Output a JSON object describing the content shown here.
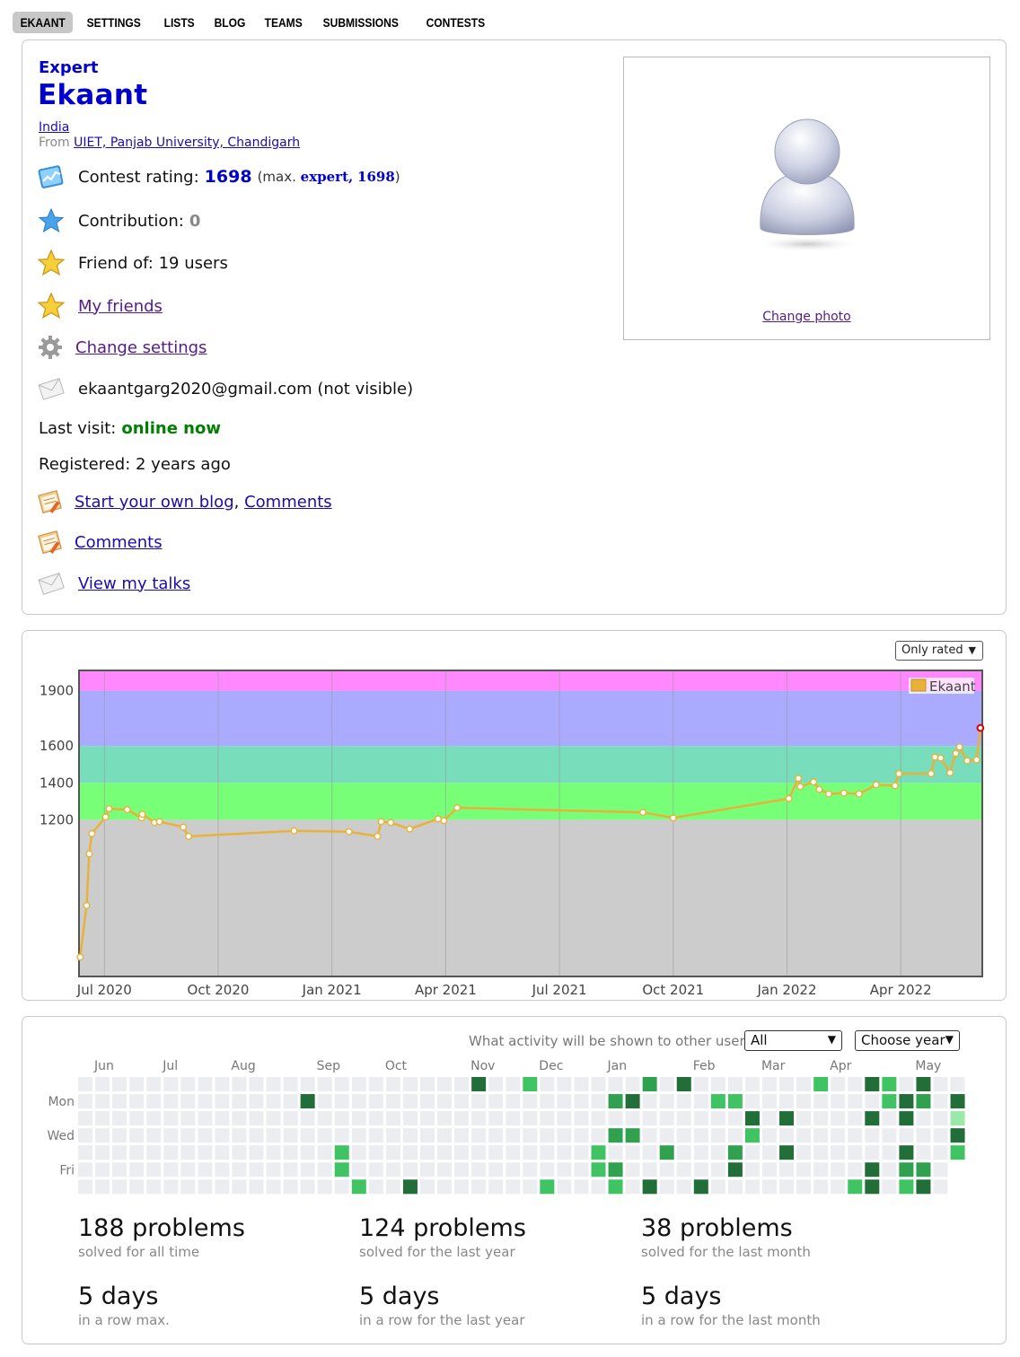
{
  "nav": {
    "tabs": [
      {
        "label": "EKAANT",
        "active": true
      },
      {
        "label": "SETTINGS"
      },
      {
        "label": "LISTS"
      },
      {
        "label": "BLOG"
      },
      {
        "label": "TEAMS"
      },
      {
        "label": "SUBMISSIONS"
      },
      {
        "label": "CONTESTS"
      }
    ]
  },
  "profile": {
    "rank": "Expert",
    "handle": "Ekaant",
    "country": "India",
    "from_label": "From",
    "organization": "UIET, Panjab University, Chandigarh",
    "rating_label": "Contest rating:",
    "rating": "1698",
    "max_prefix": "(max.",
    "max_rank": "expert,",
    "max_rating": "1698",
    "max_suffix": ")",
    "contribution_label": "Contribution:",
    "contribution": "0",
    "friend_of": "Friend of: 19 users",
    "my_friends": "My friends",
    "change_settings": "Change settings",
    "email": "ekaantgarg2020@gmail.com (not visible)",
    "last_visit_label": "Last visit:",
    "last_visit": "online now",
    "registered": "Registered: 2 years ago",
    "blog_link": "Start your own blog",
    "comma": ",",
    "comments_link": "Comments",
    "comments_link2": "Comments",
    "talks_link": "View my talks",
    "change_photo": "Change photo"
  },
  "rating_chart": {
    "filter": "Only rated"
  },
  "chart_data": {
    "type": "line",
    "legend": "Ekaant",
    "x_ticks": [
      "Jul 2020",
      "Oct 2020",
      "Jan 2021",
      "Apr 2021",
      "Jul 2021",
      "Oct 2021",
      "Jan 2022",
      "Apr 2022"
    ],
    "x_tick_months": [
      0,
      3,
      6,
      9,
      12,
      15,
      18,
      21
    ],
    "y_ticks": [
      1200,
      1400,
      1600,
      1900
    ],
    "ylim": [
      350,
      2010
    ],
    "bands": [
      {
        "from": 350,
        "to": 1200,
        "color": "#cccccc"
      },
      {
        "from": 1200,
        "to": 1400,
        "color": "#77ff77"
      },
      {
        "from": 1400,
        "to": 1600,
        "color": "#77ddbb"
      },
      {
        "from": 1600,
        "to": 1900,
        "color": "#aaaaff"
      },
      {
        "from": 1900,
        "to": 2010,
        "color": "#ff88ff"
      }
    ],
    "line_color": "#e8b23a",
    "highlight_color": "#dd0000",
    "points": [
      {
        "m": -0.64,
        "r": 455
      },
      {
        "m": -0.47,
        "r": 735
      },
      {
        "m": -0.4,
        "r": 1015
      },
      {
        "m": -0.33,
        "r": 1125
      },
      {
        "m": 0.03,
        "r": 1215
      },
      {
        "m": 0.12,
        "r": 1260
      },
      {
        "m": 0.6,
        "r": 1255
      },
      {
        "m": 0.98,
        "r": 1210
      },
      {
        "m": 1.0,
        "r": 1230
      },
      {
        "m": 1.32,
        "r": 1185
      },
      {
        "m": 1.45,
        "r": 1190
      },
      {
        "m": 2.08,
        "r": 1160
      },
      {
        "m": 2.22,
        "r": 1110
      },
      {
        "m": 5.0,
        "r": 1140
      },
      {
        "m": 6.45,
        "r": 1135
      },
      {
        "m": 7.2,
        "r": 1110
      },
      {
        "m": 7.3,
        "r": 1190
      },
      {
        "m": 7.55,
        "r": 1185
      },
      {
        "m": 8.05,
        "r": 1150
      },
      {
        "m": 8.8,
        "r": 1205
      },
      {
        "m": 8.95,
        "r": 1195
      },
      {
        "m": 9.3,
        "r": 1265
      },
      {
        "m": 14.2,
        "r": 1240
      },
      {
        "m": 15.0,
        "r": 1210
      },
      {
        "m": 18.05,
        "r": 1315
      },
      {
        "m": 18.3,
        "r": 1425
      },
      {
        "m": 18.35,
        "r": 1380
      },
      {
        "m": 18.7,
        "r": 1405
      },
      {
        "m": 18.85,
        "r": 1365
      },
      {
        "m": 19.1,
        "r": 1340
      },
      {
        "m": 19.5,
        "r": 1345
      },
      {
        "m": 19.9,
        "r": 1340
      },
      {
        "m": 20.35,
        "r": 1390
      },
      {
        "m": 20.85,
        "r": 1385
      },
      {
        "m": 20.95,
        "r": 1450
      },
      {
        "m": 21.8,
        "r": 1450
      },
      {
        "m": 21.9,
        "r": 1540
      },
      {
        "m": 22.05,
        "r": 1535
      },
      {
        "m": 22.3,
        "r": 1455
      },
      {
        "m": 22.45,
        "r": 1560
      },
      {
        "m": 22.55,
        "r": 1595
      },
      {
        "m": 22.75,
        "r": 1520
      },
      {
        "m": 23.0,
        "r": 1525
      },
      {
        "m": 23.1,
        "r": 1698
      }
    ]
  },
  "activity": {
    "visibility_label": "What activity will be shown to other users:",
    "visibility_value": "All",
    "year_value": "Choose year",
    "months": [
      {
        "label": "Jun",
        "week": 0
      },
      {
        "label": "Jul",
        "week": 4
      },
      {
        "label": "Aug",
        "week": 8
      },
      {
        "label": "Sep",
        "week": 13
      },
      {
        "label": "Oct",
        "week": 17
      },
      {
        "label": "Nov",
        "week": 22
      },
      {
        "label": "Dec",
        "week": 26
      },
      {
        "label": "Jan",
        "week": 30
      },
      {
        "label": "Feb",
        "week": 35
      },
      {
        "label": "Mar",
        "week": 39
      },
      {
        "label": "Apr",
        "week": 43
      },
      {
        "label": "May",
        "week": 48
      }
    ],
    "day_labels": [
      {
        "label": "Mon",
        "row": 1
      },
      {
        "label": "Wed",
        "row": 3
      },
      {
        "label": "Fri",
        "row": 5
      }
    ],
    "weeks": 52,
    "last_week_rows": 5,
    "colors": [
      "#ebedf0",
      "#9be9a8",
      "#40c463",
      "#30a14e",
      "#216e39"
    ],
    "cells": [
      [
        13,
        1,
        4
      ],
      [
        15,
        4,
        2
      ],
      [
        15,
        5,
        2
      ],
      [
        16,
        6,
        2
      ],
      [
        19,
        6,
        4
      ],
      [
        23,
        0,
        4
      ],
      [
        26,
        0,
        2
      ],
      [
        27,
        6,
        2
      ],
      [
        30,
        4,
        2
      ],
      [
        30,
        5,
        2
      ],
      [
        31,
        1,
        3
      ],
      [
        31,
        3,
        3
      ],
      [
        31,
        5,
        3
      ],
      [
        31,
        6,
        2
      ],
      [
        32,
        1,
        4
      ],
      [
        32,
        3,
        3
      ],
      [
        33,
        0,
        3
      ],
      [
        33,
        6,
        4
      ],
      [
        34,
        4,
        3
      ],
      [
        35,
        0,
        4
      ],
      [
        36,
        6,
        4
      ],
      [
        37,
        1,
        2
      ],
      [
        38,
        1,
        2
      ],
      [
        38,
        4,
        3
      ],
      [
        38,
        5,
        4
      ],
      [
        39,
        2,
        4
      ],
      [
        39,
        3,
        2
      ],
      [
        41,
        2,
        4
      ],
      [
        41,
        4,
        4
      ],
      [
        43,
        0,
        2
      ],
      [
        45,
        6,
        2
      ],
      [
        46,
        0,
        4
      ],
      [
        46,
        2,
        4
      ],
      [
        46,
        5,
        4
      ],
      [
        46,
        6,
        4
      ],
      [
        47,
        0,
        2
      ],
      [
        47,
        1,
        2
      ],
      [
        48,
        1,
        4
      ],
      [
        48,
        2,
        4
      ],
      [
        48,
        4,
        4
      ],
      [
        48,
        5,
        3
      ],
      [
        48,
        6,
        2
      ],
      [
        49,
        0,
        4
      ],
      [
        49,
        1,
        3
      ],
      [
        49,
        5,
        3
      ],
      [
        49,
        6,
        4
      ],
      [
        51,
        1,
        4
      ],
      [
        51,
        2,
        1
      ],
      [
        51,
        3,
        4
      ],
      [
        51,
        4,
        2
      ]
    ]
  },
  "stats": [
    {
      "big": "188 problems",
      "small": "solved for all time"
    },
    {
      "big": "124 problems",
      "small": "solved for the last year"
    },
    {
      "big": "38 problems",
      "small": "solved for the last month"
    },
    {
      "big": "5 days",
      "small": "in a row max."
    },
    {
      "big": "5 days",
      "small": "in a row for the last year"
    },
    {
      "big": "5 days",
      "small": "in a row for the last month"
    }
  ]
}
